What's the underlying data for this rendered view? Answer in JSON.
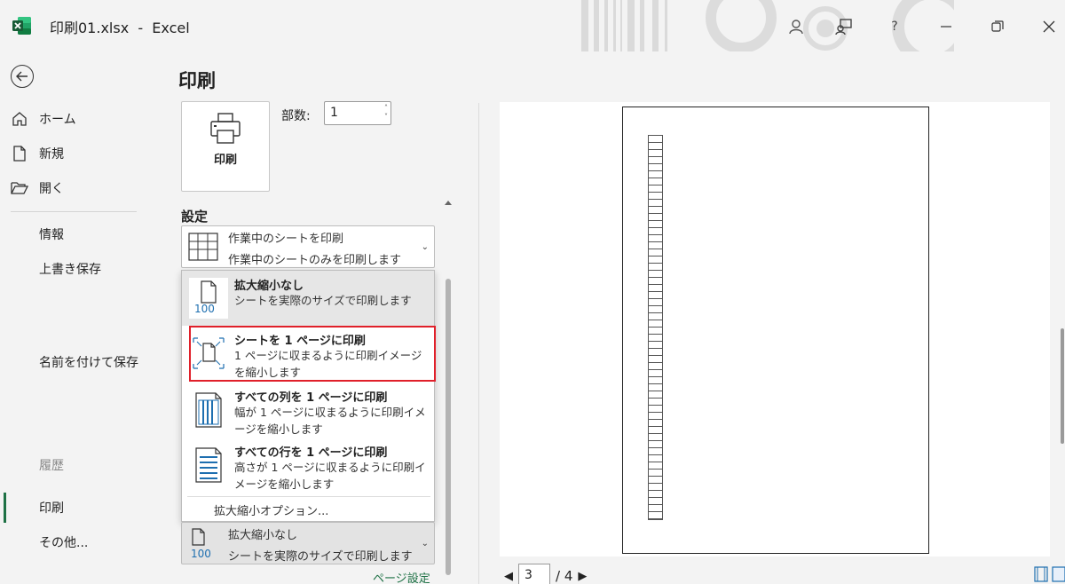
{
  "window": {
    "filename": "印刷01.xlsx",
    "separator": "-",
    "app": "Excel"
  },
  "nav": {
    "items": [
      {
        "label": "ホーム",
        "icon": "home-icon"
      },
      {
        "label": "新規",
        "icon": "new-document-icon"
      },
      {
        "label": "開く",
        "icon": "folder-open-icon"
      },
      {
        "label": "情報"
      },
      {
        "label": "上書き保存"
      },
      {
        "label": "名前を付けて保存"
      },
      {
        "label": "履歴"
      },
      {
        "label": "印刷"
      },
      {
        "label": "その他..."
      }
    ],
    "active": "印刷"
  },
  "print": {
    "title": "印刷",
    "button_label": "印刷",
    "copies_label": "部数:",
    "copies_value": "1"
  },
  "settings": {
    "label": "設定",
    "print_what": {
      "title": "作業中のシートを印刷",
      "desc": "作業中のシートのみを印刷します"
    },
    "scaling_menu": [
      {
        "title": "拡大縮小なし",
        "desc": "シートを実際のサイズで印刷します",
        "icon_text": "100"
      },
      {
        "title": "シートを 1 ページに印刷",
        "desc": "1 ページに収まるように印刷イメージを縮小します"
      },
      {
        "title": "すべての列を 1 ページに印刷",
        "desc": "幅が 1 ページに収まるように印刷イメージを縮小します"
      },
      {
        "title": "すべての行を 1 ページに印刷",
        "desc": "高さが 1 ページに収まるように印刷イメージを縮小します"
      }
    ],
    "scaling_options": "拡大縮小オプション...",
    "scaling_current": {
      "title": "拡大縮小なし",
      "desc": "シートを実際のサイズで印刷します",
      "icon_text": "100"
    },
    "page_setup_link": "ページ設定"
  },
  "preview": {
    "current_page": "3",
    "total_pages": "/ 4"
  },
  "colors": {
    "accent": "#1e7145",
    "highlight_border": "#e0202a"
  }
}
